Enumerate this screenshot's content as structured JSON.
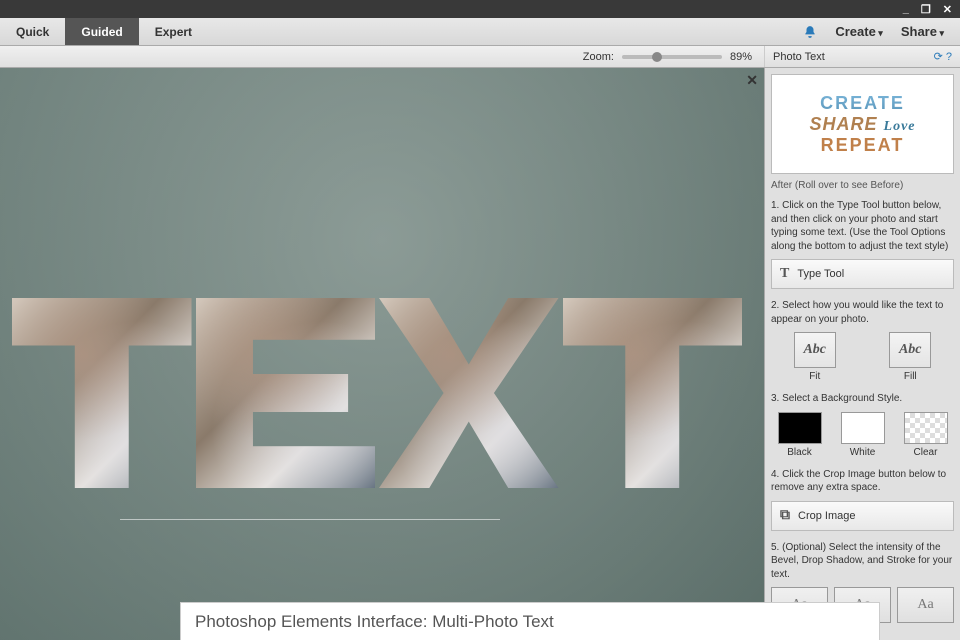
{
  "titlebar": {
    "minimize": "_",
    "maximize": "❐",
    "close": "✕"
  },
  "modes": {
    "quick": "Quick",
    "guided": "Guided",
    "expert": "Expert"
  },
  "topmenu": {
    "create": "Create",
    "share": "Share"
  },
  "optbar": {
    "zoom_label": "Zoom:",
    "zoom_value": "89%",
    "panel_title": "Photo Text",
    "help": "⟳ ?"
  },
  "canvas": {
    "close": "✕"
  },
  "preview": {
    "line1": "CREATE",
    "line2a": "SHARE",
    "line2b": "Love",
    "line3": "REPEAT"
  },
  "panel": {
    "caption": "After (Roll over to see Before)",
    "step1": "1. Click on the Type Tool button below, and then click on your photo and start typing some text. (Use the Tool Options along the bottom to adjust the text style)",
    "type_tool": "Type Tool",
    "step2": "2. Select how you would like the text to appear on your photo.",
    "fit": "Fit",
    "fill": "Fill",
    "abc": "Abc",
    "step3": "3. Select a Background Style.",
    "black": "Black",
    "white": "White",
    "clear": "Clear",
    "step4": "4. Click the Crop Image button below to remove any extra space.",
    "crop": "Crop Image",
    "step5": "5. (Optional) Select the intensity of the Bevel, Drop Shadow, and Stroke for your text.",
    "aa": "Aa"
  },
  "footer": "Photoshop Elements Interface: Multi-Photo Text"
}
